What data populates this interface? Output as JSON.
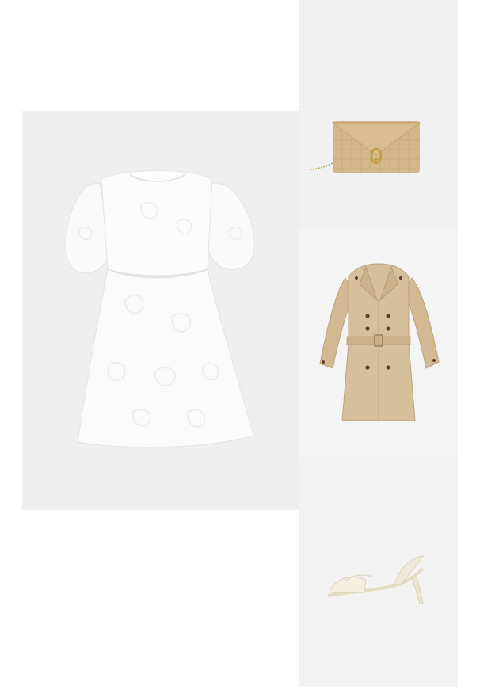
{
  "outfit": {
    "items": [
      {
        "id": "dress",
        "product": "dress",
        "color": "#fbfbfb",
        "tile_color": "#efefef"
      },
      {
        "id": "clutch",
        "product": "clutch-bag",
        "color": "#d5b98e",
        "tile_color": "#f1f1f1"
      },
      {
        "id": "coat",
        "product": "trench-coat",
        "color": "#d5bd98",
        "tile_color": "#f4f4f4"
      },
      {
        "id": "sandal",
        "product": "slingback-sandal",
        "color": "#f3ecdc",
        "tile_color": "#f2f2f2"
      }
    ]
  }
}
